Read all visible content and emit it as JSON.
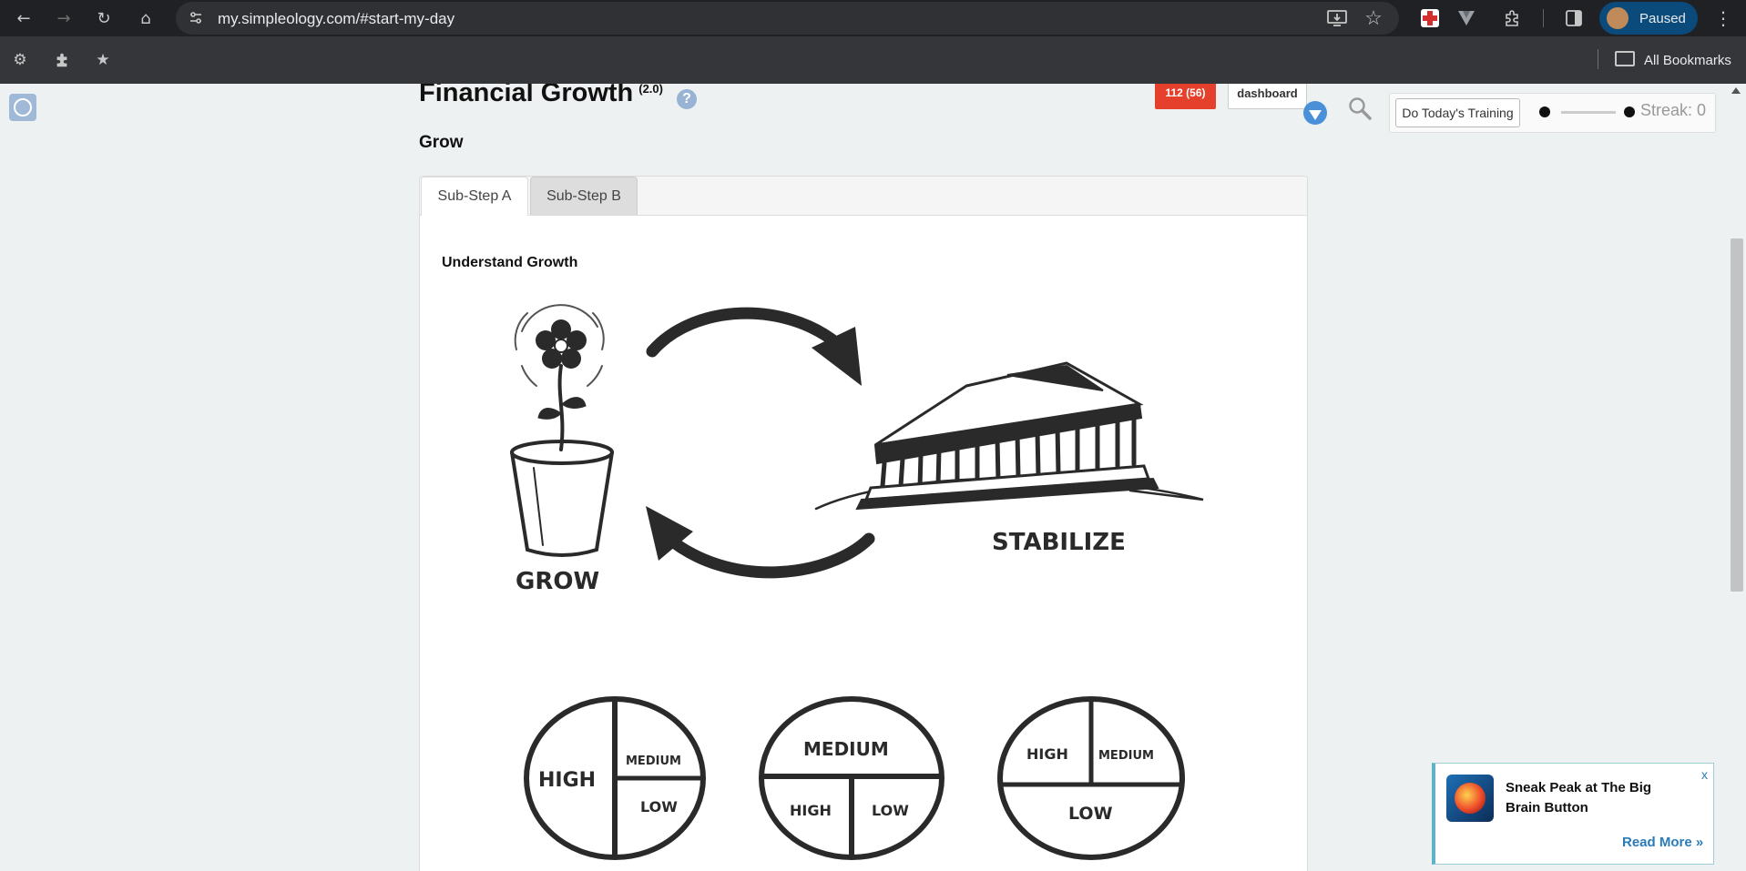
{
  "browser": {
    "url": "my.simpleology.com/#start-my-day",
    "profile_label": "Paused",
    "all_bookmarks": "All Bookmarks"
  },
  "header": {
    "title": "Financial Growth",
    "version": "(2.0)",
    "help_glyph": "?",
    "subtitle": "Grow",
    "badge": "112 (56)",
    "dashboard_label": "dashboard",
    "training_button": "Do Today's Training",
    "streak": "Streak: 0"
  },
  "tabs": [
    {
      "label": "Sub-Step A",
      "active": true
    },
    {
      "label": "Sub-Step B",
      "active": false
    }
  ],
  "content": {
    "heading": "Understand Growth",
    "grow_label": "GROW",
    "stabilize_label": "STABILIZE",
    "pies": [
      {
        "a": "HIGH",
        "b": "MEDIUM",
        "c": "LOW"
      },
      {
        "a": "MEDIUM",
        "b": "HIGH",
        "c": "LOW"
      },
      {
        "a": "HIGH",
        "b": "MEDIUM",
        "c": "LOW"
      }
    ]
  },
  "toast": {
    "title": "Sneak Peak at The Big Brain Button",
    "read_more": "Read More »",
    "close": "x"
  }
}
